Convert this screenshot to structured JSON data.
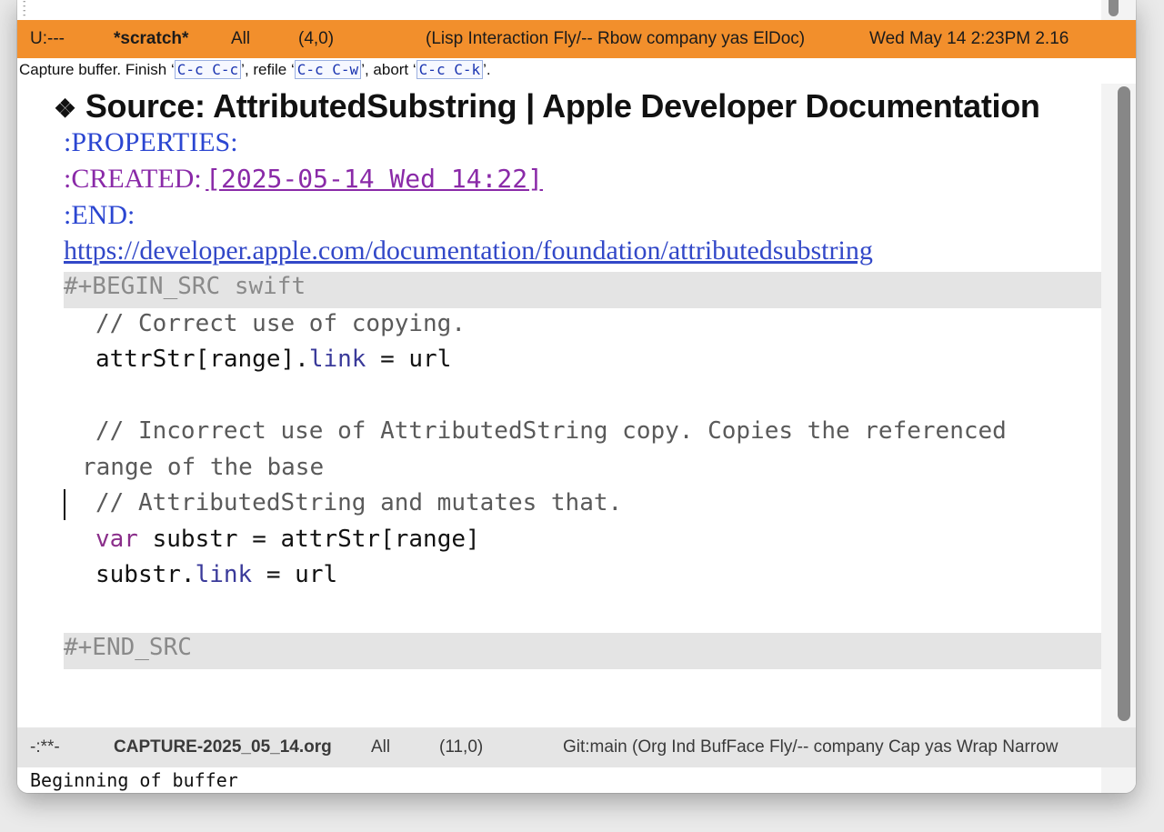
{
  "top_modeline": {
    "status": "U:---",
    "buffer": "*scratch*",
    "position_all": "All",
    "cursor_pos": "(4,0)",
    "modes": "(Lisp Interaction Fly/-- Rbow company yas ElDoc)",
    "datetime": "Wed May 14 2:23PM 2.16"
  },
  "echo": {
    "text1": "Capture buffer.  Finish ‘",
    "key_finish": "C-c C-c",
    "text2": "’, refile ‘",
    "key_refile": "C-c C-w",
    "text3": "’, abort ‘",
    "key_abort": "C-c C-k",
    "text4": "’."
  },
  "editor": {
    "heading_bullet": "❖",
    "heading": "Source: AttributedSubstring | Apple Developer Documentation",
    "properties_start": ":PROPERTIES:",
    "created_key": ":CREATED:",
    "created_value": "[2025-05-14 Wed 14:22]",
    "properties_end": ":END:",
    "url": "https://developer.apple.com/documentation/foundation/attributedsubstring",
    "begin_src": "#+BEGIN_SRC swift",
    "code": {
      "comment1": "// Correct use of copying.",
      "line2_a": "attrStr[range].",
      "line2_prop": "link",
      "line2_b": " = url",
      "comment2a": "// Incorrect use of AttributedString copy. Copies the referenced",
      "comment2b": "range of the base",
      "comment3": "// AttributedString and mutates that.",
      "line_var_kw": "var",
      "line_var_rest": " substr = attrStr[range]",
      "line_last_a": "substr.",
      "line_last_prop": "link",
      "line_last_b": " = url"
    },
    "end_src": "#+END_SRC"
  },
  "bottom_modeline": {
    "status": "-:**-",
    "filename": "CAPTURE-2025_05_14.org",
    "position_all": "All",
    "cursor_pos": "(11,0)",
    "modes": "Git:main  (Org Ind BufFace Fly/-- company Cap yas Wrap Narrow"
  },
  "minibuffer": {
    "message": "Beginning of buffer"
  },
  "colors": {
    "top_modeline_bg": "#f28f2c",
    "property_blue": "#2b46d1",
    "timestamp_purple": "#8a2aa8",
    "link_blue": "#3248c8",
    "src_block_bg": "#e4e4e4"
  }
}
